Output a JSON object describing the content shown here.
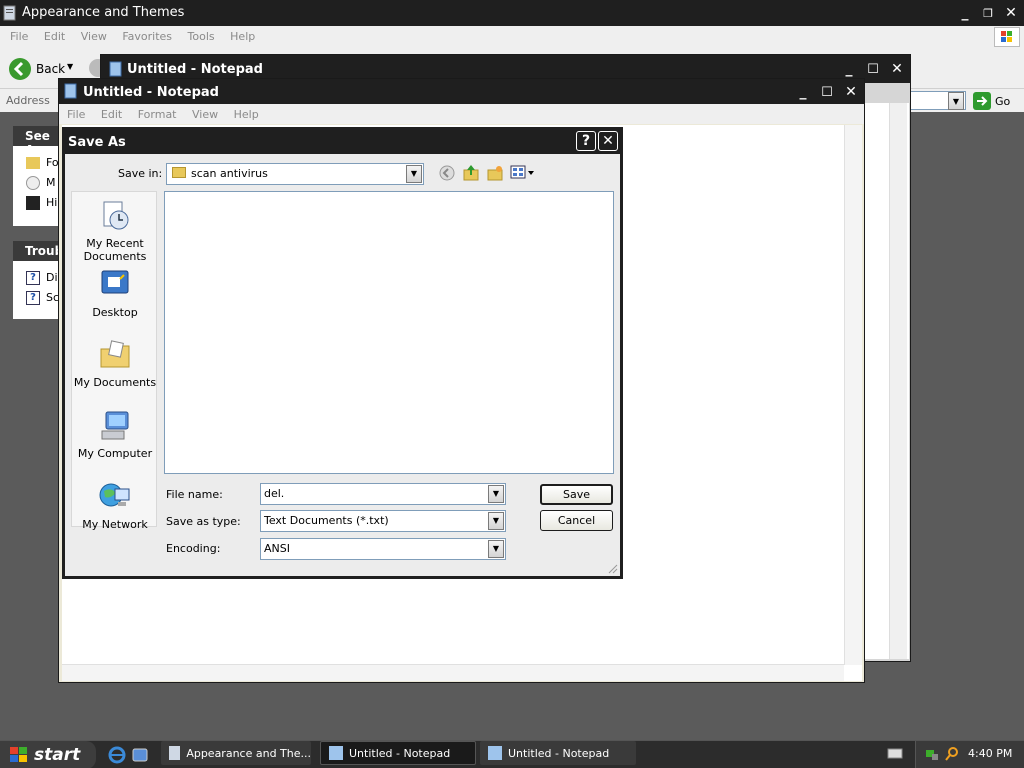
{
  "explorer": {
    "title": "Appearance and Themes",
    "menu": [
      "File",
      "Edit",
      "View",
      "Favorites",
      "Tools",
      "Help"
    ],
    "back_label": "Back",
    "address_label": "Address",
    "go_label": "Go",
    "see_also_header": "See A",
    "troubleshooters_header": "Troub",
    "see_also_items": [
      "Fo",
      "M",
      "Hi"
    ],
    "troubleshooter_items": [
      "Di",
      "Sc"
    ]
  },
  "notepad_back": {
    "title": "Untitled - Notepad"
  },
  "notepad_front": {
    "title": "Untitled - Notepad",
    "menu": [
      "File",
      "Edit",
      "Format",
      "View",
      "Help"
    ]
  },
  "save_as": {
    "title": "Save As",
    "help_symbol": "?",
    "save_in_label": "Save in:",
    "save_in_value": "scan antivirus",
    "places": [
      {
        "label": "My Recent Documents",
        "icon": "recent-documents-icon"
      },
      {
        "label": "Desktop",
        "icon": "desktop-icon"
      },
      {
        "label": "My Documents",
        "icon": "my-documents-icon"
      },
      {
        "label": "My Computer",
        "icon": "my-computer-icon"
      },
      {
        "label": "My Network",
        "icon": "my-network-icon"
      }
    ],
    "file_name_label": "File name:",
    "file_name_value": "del.",
    "save_type_label": "Save as type:",
    "save_type_value": "Text Documents (*.txt)",
    "encoding_label": "Encoding:",
    "encoding_value": "ANSI",
    "save_button": "Save",
    "cancel_button": "Cancel"
  },
  "taskbar": {
    "start_label": "start",
    "tasks": [
      "Appearance and The...",
      "Untitled - Notepad",
      "Untitled - Notepad"
    ],
    "clock": "4:40 PM"
  },
  "colors": {
    "titlebar": "#1f1f1f",
    "taskbar": "#2c2c2c",
    "start": "#3d3d3d",
    "field_border": "#7f9db9"
  }
}
